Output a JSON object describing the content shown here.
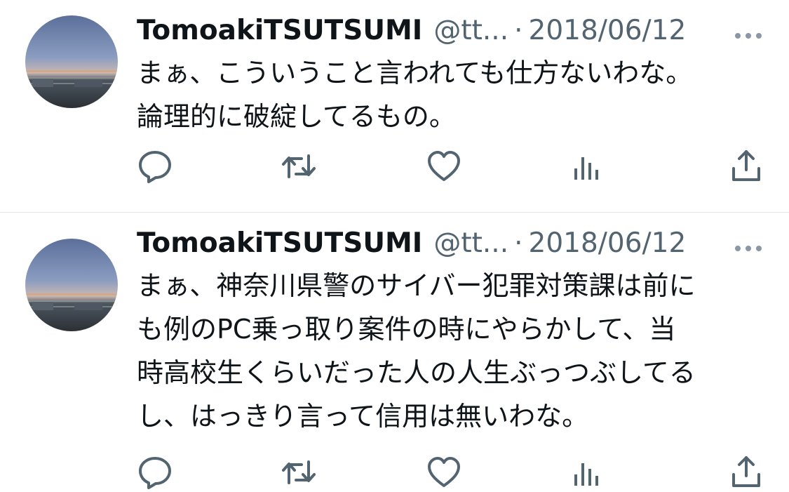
{
  "tweets": [
    {
      "display_name": "TomoakiTSUTSUMI",
      "handle": "@tt...",
      "separator": "·",
      "date": "2018/06/12",
      "text": "まぁ、こういうこと言われても仕方ないわな。\n論理的に破綻してるもの。",
      "avatar": "avatar-dusk-photo"
    },
    {
      "display_name": "TomoakiTSUTSUMI",
      "handle": "@tt...",
      "separator": "·",
      "date": "2018/06/12",
      "text": "まぁ、神奈川県警のサイバー犯罪対策課は前に\nも例のPC乗っ取り案件の時にやらかして、当\n時高校生くらいだった人の人生ぶっつぶしてる\nし、はっきり言って信用は無いわな。",
      "avatar": "avatar-dusk-photo"
    }
  ],
  "action_icons": [
    "reply-icon",
    "retweet-icon",
    "like-icon",
    "views-icon",
    "share-icon"
  ],
  "menu_icon": "more-options-icon",
  "colors": {
    "text": "#0f1419",
    "secondary": "#536471",
    "divider": "#e1e5e9",
    "background": "#ffffff"
  }
}
